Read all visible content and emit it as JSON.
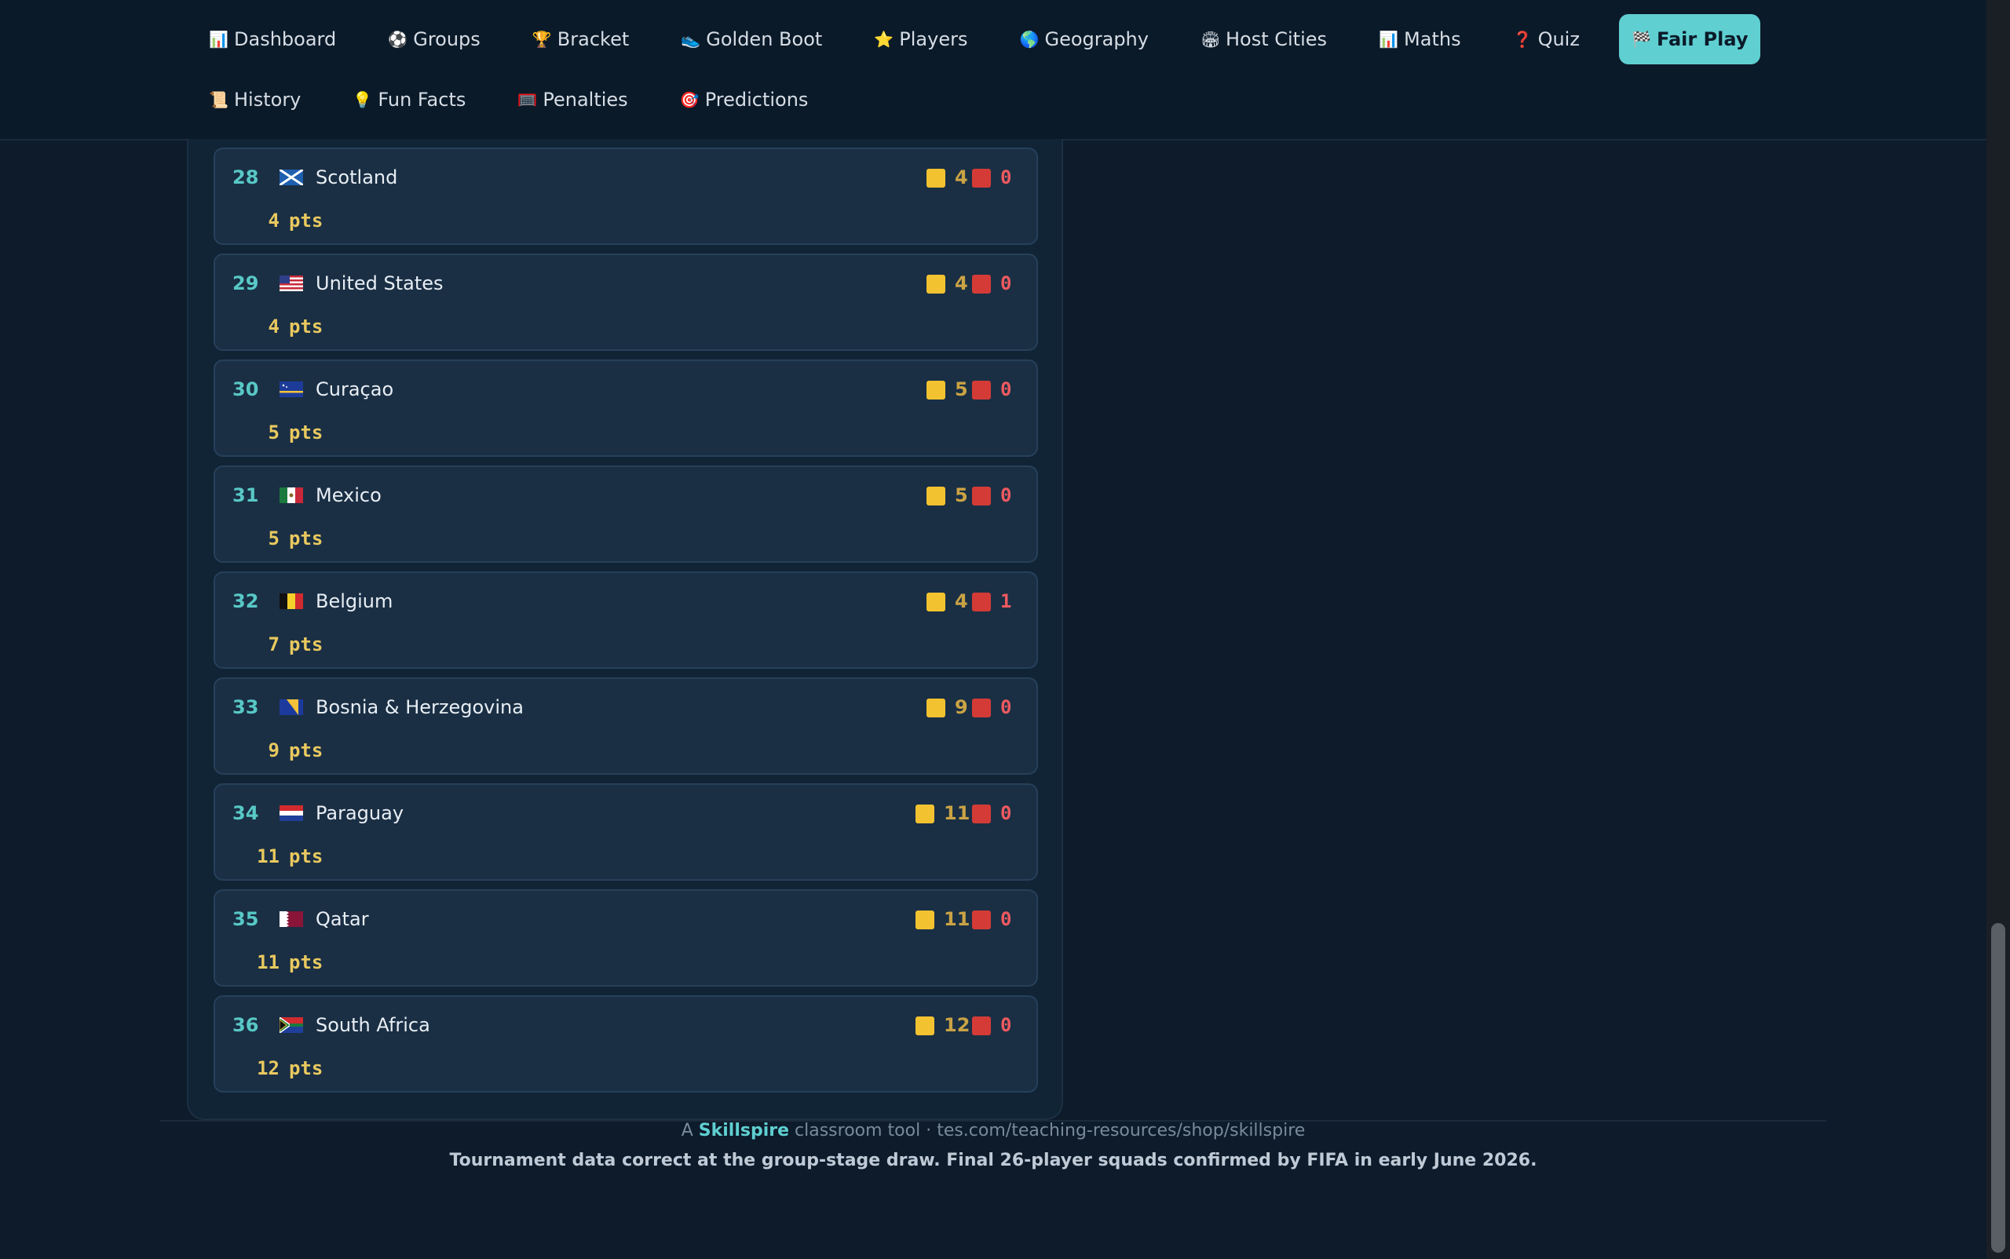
{
  "nav": {
    "row1": [
      {
        "icon": "📊",
        "icon_name": "bar-chart-icon",
        "label": "Dashboard"
      },
      {
        "icon": "⚽",
        "icon_name": "soccer-ball-icon",
        "label": "Groups"
      },
      {
        "icon": "🏆",
        "icon_name": "trophy-icon",
        "label": "Bracket"
      },
      {
        "icon": "👟",
        "icon_name": "boot-icon",
        "label": "Golden Boot"
      },
      {
        "icon": "⭐",
        "icon_name": "star-icon",
        "label": "Players"
      },
      {
        "icon": "🌎",
        "icon_name": "globe-icon",
        "label": "Geography"
      },
      {
        "icon": "🏟",
        "icon_name": "stadium-icon",
        "label": "Host Cities"
      },
      {
        "icon": "📊",
        "icon_name": "bar-chart-icon",
        "label": "Maths"
      },
      {
        "icon": "❓",
        "icon_name": "question-icon",
        "label": "Quiz"
      },
      {
        "icon": "🏁",
        "icon_name": "checkered-flag-icon",
        "label": "Fair Play",
        "active": true
      }
    ],
    "row2": [
      {
        "icon": "📜",
        "icon_name": "scroll-icon",
        "label": "History"
      },
      {
        "icon": "💡",
        "icon_name": "lightbulb-icon",
        "label": "Fun Facts"
      },
      {
        "icon": "🥅",
        "icon_name": "goal-icon",
        "label": "Penalties"
      },
      {
        "icon": "🎯",
        "icon_name": "target-icon",
        "label": "Predictions"
      }
    ]
  },
  "colors": {
    "accent": "#5fcfd1",
    "yellow_card": "#f2c230",
    "red_card": "#d43b37",
    "background": "#0d1b2a"
  },
  "fair_play": {
    "pts_suffix": "pts",
    "rows": [
      {
        "rank": "28",
        "team": "Scotland",
        "yellow": "4",
        "red": "0",
        "pts": "4"
      },
      {
        "rank": "29",
        "team": "United States",
        "yellow": "4",
        "red": "0",
        "pts": "4"
      },
      {
        "rank": "30",
        "team": "Curaçao",
        "yellow": "5",
        "red": "0",
        "pts": "5"
      },
      {
        "rank": "31",
        "team": "Mexico",
        "yellow": "5",
        "red": "0",
        "pts": "5"
      },
      {
        "rank": "32",
        "team": "Belgium",
        "yellow": "4",
        "red": "1",
        "pts": "7"
      },
      {
        "rank": "33",
        "team": "Bosnia & Herzegovina",
        "yellow": "9",
        "red": "0",
        "pts": "9"
      },
      {
        "rank": "34",
        "team": "Paraguay",
        "yellow": "11",
        "red": "0",
        "pts": "11"
      },
      {
        "rank": "35",
        "team": "Qatar",
        "yellow": "11",
        "red": "0",
        "pts": "11"
      },
      {
        "rank": "36",
        "team": "South Africa",
        "yellow": "12",
        "red": "0",
        "pts": "12"
      }
    ]
  },
  "footer": {
    "prefix": "A",
    "brand": "Skillspire",
    "suffix": "classroom tool · tes.com/teaching-resources/shop/skillspire",
    "note": "Tournament data correct at the group-stage draw. Final 26-player squads confirmed by FIFA in early June 2026."
  }
}
